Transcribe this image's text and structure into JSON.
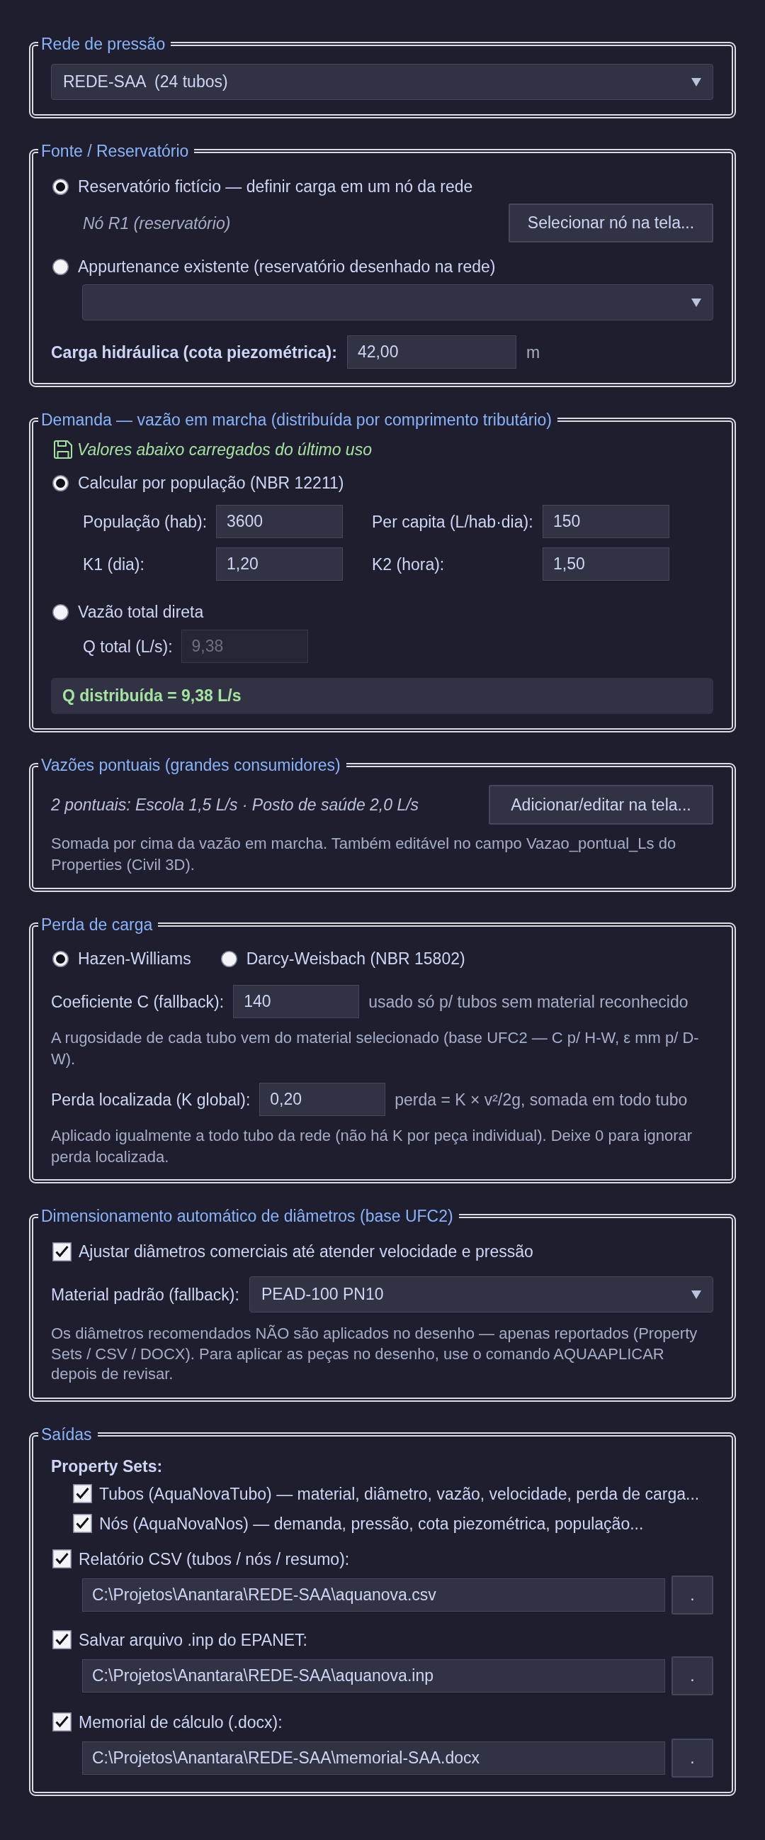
{
  "network": {
    "legend": "Rede de pressão",
    "dropdown": {
      "value": "REDE-SAA  (24 tubos)"
    }
  },
  "source": {
    "legend": "Fonte / Reservatório",
    "options": [
      {
        "kind": "pick",
        "label": "Reservatório fictício — definir carga em um nó da rede",
        "selected": true,
        "node": "Nó R1 (reservatório)",
        "button": "Selecionar nó na tela..."
      },
      {
        "kind": "dropdown",
        "label": "Appurtenance existente (reservatório desenhado na rede)",
        "selected": false
      }
    ],
    "head": {
      "label": "Carga hidráulica (cota piezométrica):",
      "value": "42,00",
      "unit": "m"
    }
  },
  "demand": {
    "legend": "Demanda — vazão em marcha (distribuída por comprimento tributário)",
    "note": "Valores abaixo carregados do último uso",
    "modes": [
      {
        "label": "Calcular por população (NBR 12211)",
        "selected": true,
        "fields": [
          {
            "label": "População (hab):",
            "value": "3600",
            "disabled": false
          },
          {
            "label": "Per capita (L/hab·dia):",
            "value": "150",
            "disabled": false
          },
          {
            "label": "K1 (dia):",
            "value": "1,20",
            "disabled": false
          },
          {
            "label": "K2 (hora):",
            "value": "1,50",
            "disabled": false
          }
        ]
      },
      {
        "label": "Vazão total direta",
        "selected": false,
        "fields": [
          {
            "label": "Q total (L/s):",
            "value": "9,38",
            "disabled": true
          }
        ]
      }
    ],
    "result": "Q distribuída = 9,38 L/s"
  },
  "point_flows": {
    "legend": "Vazões pontuais (grandes consumidores)",
    "summary": "2 pontuais: Escola 1,5 L/s · Posto de saúde 2,0 L/s",
    "button": "Adicionar/editar na tela...",
    "hint": "Somada por cima da vazão em marcha. Também editável no campo Vazao_pontual_Ls do Properties (Civil 3D)."
  },
  "head_loss": {
    "legend": "Perda de carga",
    "methods": [
      {
        "label": "Hazen-Williams",
        "selected": true
      },
      {
        "label": "Darcy-Weisbach (NBR 15802)",
        "selected": false
      }
    ],
    "params": [
      {
        "label": "Coeficiente C (fallback):",
        "value": "140",
        "note": "usado só p/ tubos sem material reconhecido",
        "hint": "A rugosidade de cada tubo vem do material selecionado (base UFC2 — C p/ H-W, ε mm p/ D-W)."
      },
      {
        "label": "Perda localizada (K global):",
        "value": "0,20",
        "note": "perda = K × v²/2g, somada em todo tubo",
        "hint": "Aplicado igualmente a todo tubo da rede (não há K por peça individual). Deixe 0 para ignorar perda localizada."
      }
    ]
  },
  "sizing": {
    "legend": "Dimensionamento automático de diâmetros (base UFC2)",
    "auto": {
      "label": "Ajustar diâmetros comerciais até atender velocidade e pressão",
      "checked": true
    },
    "material": {
      "label": "Material padrão (fallback):",
      "value": "PEAD-100 PN10"
    },
    "hint": "Os diâmetros recomendados NÃO são aplicados no desenho — apenas reportados (Property Sets / CSV / DOCX). Para aplicar as peças no desenho, use o comando AQUAAPLICAR depois de revisar."
  },
  "outputs": {
    "legend": "Saídas",
    "property_sets": {
      "label": "Property Sets:",
      "items": [
        {
          "label": "Tubos (AquaNovaTubo) — material, diâmetro, vazão, velocidade, perda de carga...",
          "checked": true
        },
        {
          "label": "Nós (AquaNovaNos) — demanda, pressão, cota piezométrica, população...",
          "checked": true
        }
      ]
    },
    "files": [
      {
        "label": "Relatório CSV (tubos / nós / resumo):",
        "checked": true,
        "path": "C:\\Projetos\\Anantara\\REDE-SAA\\aquanova.csv",
        "browse": "."
      },
      {
        "label": "Salvar arquivo .inp do EPANET:",
        "checked": true,
        "path": "C:\\Projetos\\Anantara\\REDE-SAA\\aquanova.inp",
        "browse": "."
      },
      {
        "label": "Memorial de cálculo (.docx):",
        "checked": true,
        "path": "C:\\Projetos\\Anantara\\REDE-SAA\\memorial-SAA.docx",
        "browse": "."
      }
    ]
  }
}
